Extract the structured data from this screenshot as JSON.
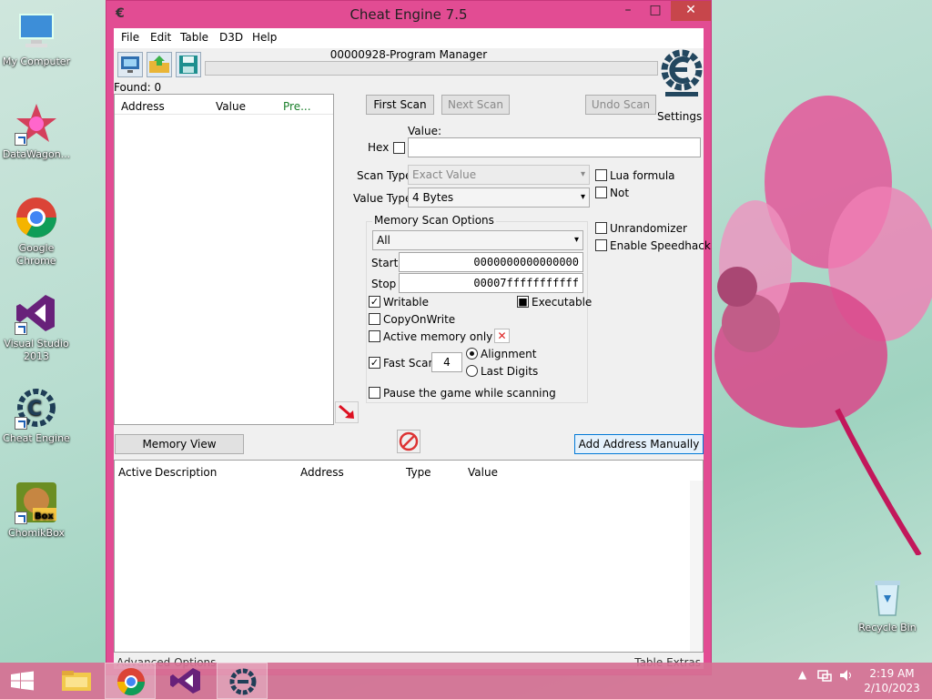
{
  "desktop": {
    "icons": [
      {
        "label": "My Computer"
      },
      {
        "label": "DataWagon..."
      },
      {
        "label": "Google Chrome"
      },
      {
        "label": "Visual Studio 2013"
      },
      {
        "label": "Cheat Engine"
      },
      {
        "label": "ChomikBox"
      },
      {
        "label": "Recycle Bin"
      }
    ]
  },
  "window": {
    "title": "Cheat Engine 7.5",
    "controls": {
      "minimize": "–",
      "maximize": "□",
      "close": "✕"
    }
  },
  "menu": [
    "File",
    "Edit",
    "Table",
    "D3D",
    "Help"
  ],
  "process": "00000928-Program Manager",
  "found": "Found: 0",
  "settings_label": "Settings",
  "results_columns": [
    "Address",
    "Value",
    "Pre..."
  ],
  "scan_buttons": {
    "first": "First Scan",
    "next": "Next Scan",
    "undo": "Undo Scan"
  },
  "value": {
    "label": "Value:",
    "hex_label": "Hex",
    "current": ""
  },
  "scan_type": {
    "label": "Scan Type",
    "selected": "Exact Value"
  },
  "value_type": {
    "label": "Value Type",
    "selected": "4 Bytes"
  },
  "right_options": {
    "lua": "Lua formula",
    "not": "Not",
    "unrandomizer": "Unrandomizer",
    "speedhack": "Enable Speedhack"
  },
  "memory_scan": {
    "title": "Memory Scan Options",
    "region": "All",
    "start_label": "Start",
    "start": "0000000000000000",
    "stop_label": "Stop",
    "stop": "00007fffffffffff",
    "writable": "Writable",
    "executable": "Executable",
    "copyonwrite": "CopyOnWrite",
    "active_only": "Active memory only",
    "fast_scan": "Fast Scan",
    "fast_scan_value": "4",
    "alignment": "Alignment",
    "last_digits": "Last Digits",
    "pause": "Pause the game while scanning"
  },
  "memory_view_button": "Memory View",
  "add_address_button": "Add Address Manually",
  "address_columns": [
    "Active",
    "Description",
    "Address",
    "Type",
    "Value"
  ],
  "status": {
    "left": "Advanced Options",
    "right": "Table Extras"
  },
  "clock": {
    "time": "2:19 AM",
    "date": "2/10/2023"
  },
  "colors": {
    "window_frame": "#e24c93",
    "taskbar": "#d67094",
    "close_button": "#c7464b"
  }
}
